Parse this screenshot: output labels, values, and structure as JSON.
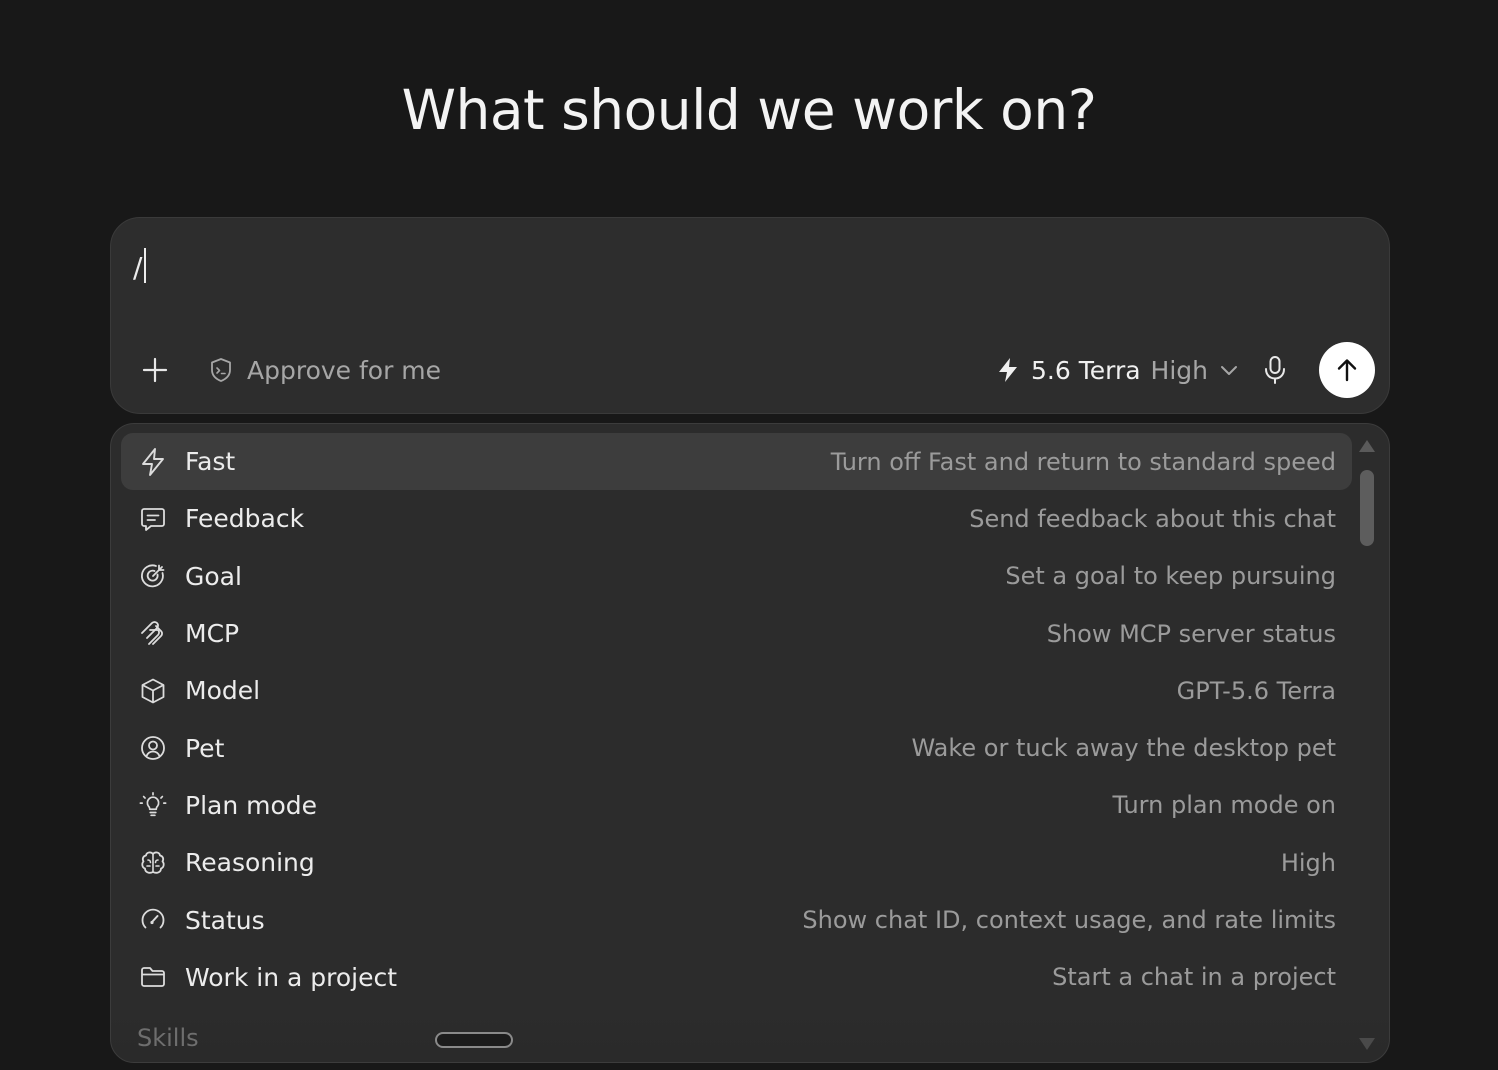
{
  "headline": "What should we work on?",
  "composer": {
    "input_value": "/",
    "approve_label": "Approve for me",
    "model_name": "5.6 Terra",
    "model_effort": "High"
  },
  "commands": [
    {
      "label": "Fast",
      "description": "Turn off Fast and return to standard speed",
      "icon": "lightning-icon",
      "active": true
    },
    {
      "label": "Feedback",
      "description": "Send feedback about this chat",
      "icon": "feedback-icon"
    },
    {
      "label": "Goal",
      "description": "Set a goal to keep pursuing",
      "icon": "goal-icon"
    },
    {
      "label": "MCP",
      "description": "Show MCP server status",
      "icon": "mcp-icon"
    },
    {
      "label": "Model",
      "description": "GPT-5.6 Terra",
      "icon": "cube-icon"
    },
    {
      "label": "Pet",
      "description": "Wake or tuck away the desktop pet",
      "icon": "pet-icon"
    },
    {
      "label": "Plan mode",
      "description": "Turn plan mode on",
      "icon": "lightbulb-icon"
    },
    {
      "label": "Reasoning",
      "description": "High",
      "icon": "brain-icon"
    },
    {
      "label": "Status",
      "description": "Show chat ID, context usage, and rate limits",
      "icon": "gauge-icon"
    },
    {
      "label": "Work in a project",
      "description": "Start a chat in a project",
      "icon": "folder-icon"
    }
  ],
  "section_label": "Skills",
  "colors": {
    "background": "#181818",
    "surface": "#2d2d2d",
    "active_row": "#3d3d3d",
    "secondary_text": "#9b9b9b",
    "send_button": "#ffffff"
  }
}
